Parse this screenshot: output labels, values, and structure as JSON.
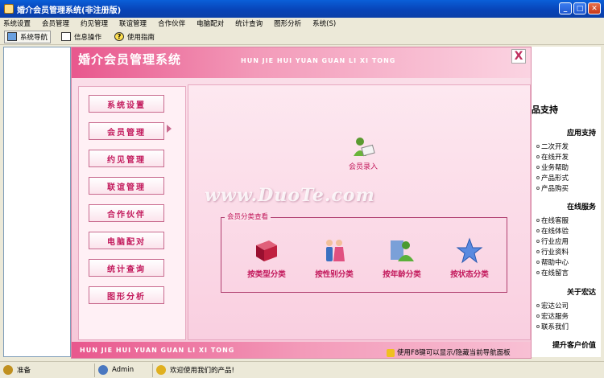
{
  "window": {
    "title": "婚介会员管理系统(非注册版)",
    "min": "_",
    "max": "□",
    "close": "✕"
  },
  "menu": [
    "系统设置",
    "会员管理",
    "约见管理",
    "联谊管理",
    "合作伙伴",
    "电脑配对",
    "统计查询",
    "图形分析",
    "系统(S)"
  ],
  "toolbar": {
    "nav_label": "系统导航",
    "info_label": "信息操作",
    "guide_label": "使用指南"
  },
  "banner": {
    "title": "婚介会员管理系统",
    "pinyin": "HUN JIE HUI YUAN GUAN LI XI TONG",
    "close": "X"
  },
  "nav": [
    "系统设置",
    "会员管理",
    "约见管理",
    "联谊管理",
    "合作伙伴",
    "电脑配对",
    "统计查询",
    "图形分析"
  ],
  "content": {
    "watermark": "www.DuoTe.com",
    "member_entry": "会员录入",
    "group_title": "会员分类查看",
    "categories": [
      "按类型分类",
      "按性别分类",
      "按年龄分类",
      "按状态分类"
    ]
  },
  "footer_pinyin": "HUN JIE HUI YUAN GUAN LI XI TONG",
  "right_panel": {
    "title": "品支持",
    "app_support": {
      "heading": "应用支持",
      "links": [
        "二次开发",
        "在线开发",
        "业务帮助",
        "产品形式",
        "产品购买"
      ]
    },
    "online": {
      "heading": "在线服务",
      "links": [
        "在线客服",
        "在线体验",
        "行业应用",
        "行业资料",
        "帮助中心",
        "在线留言"
      ]
    },
    "about": {
      "heading": "关于宏达",
      "links": [
        "宏达公司",
        "宏达服务",
        "联系我们"
      ]
    },
    "extra": "提升客户价值"
  },
  "notice": "使用F8键可以显示/隐藏当前导航面板",
  "status": {
    "ready": "准备",
    "user": "Admin",
    "welcome": "欢迎使用我们的产品!"
  }
}
